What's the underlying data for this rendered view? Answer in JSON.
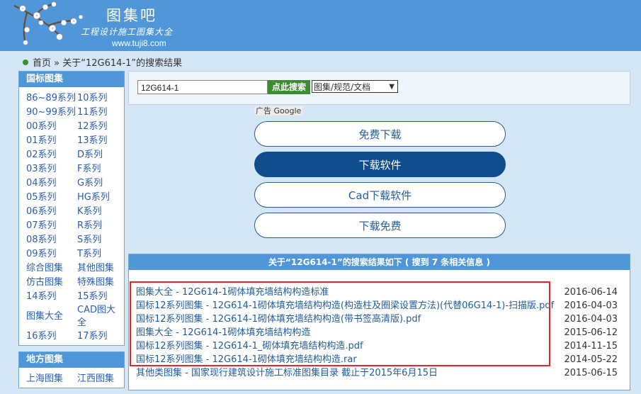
{
  "logo": {
    "title": "图集吧",
    "subtitle": "工程设计施工图集大全",
    "url": "www.tuji8.com"
  },
  "breadcrumb": {
    "home": "首页",
    "sep": "»",
    "current": "关于“12G614-1”的搜索结果"
  },
  "sidebar": {
    "national_title": "国标图集",
    "national_items": [
      "86~89系列",
      "10系列",
      "90~99系列",
      "11系列",
      "00系列",
      "12系列",
      "01系列",
      "13系列",
      "02系列",
      "D系列",
      "03系列",
      "F系列",
      "04系列",
      "G系列",
      "05系列",
      "HG系列",
      "06系列",
      "K系列",
      "07系列",
      "R系列",
      "08系列",
      "S系列",
      "09系列",
      "T系列",
      "综合图集",
      "其他图集",
      "仿古图集",
      "特殊图集",
      "14系列",
      "15系列",
      "图集大全",
      "CAD图大全",
      "16系列",
      "17系列"
    ],
    "local_title": "地方图集",
    "local_items": [
      "上海图集",
      "江西图集"
    ]
  },
  "search": {
    "value": "12G614-1",
    "button": "点此搜索",
    "select": "图集/规范/文档"
  },
  "ad": {
    "label": "广告 Google"
  },
  "buttons": [
    "免费下载",
    "下载软件",
    "Cad下载软件",
    "下载免费"
  ],
  "results": {
    "header": "关于“12G614-1”的搜索结果如下 ( 搜到 7 条相关信息 )",
    "items": [
      {
        "title": "图集大全 - 12G614-1砌体填充墙结构构造标准",
        "date": "2016-06-14"
      },
      {
        "title": "国标12系列图集 - 12G614-1砌体填充墙结构构造(构造柱及圈梁设置方法)(代替06G14-1)-扫描版.pdf",
        "date": "2016-04-03"
      },
      {
        "title": "国标12系列图集 - 12G614-1砌体填充墙结构构造(带书签高清版).pdf",
        "date": "2016-04-03"
      },
      {
        "title": "图集大全 - 12G614-1砌体填充墙结构构造",
        "date": "2015-06-12"
      },
      {
        "title": "国标12系列图集 - 12G614-1_砌体填充墙结构构造.pdf",
        "date": "2014-11-15"
      },
      {
        "title": "国标12系列图集 - 12G614-1砌体填充墙结构构造.rar",
        "date": "2014-05-22"
      },
      {
        "title": "其他类图集 - 国家现行建筑设计施工标准图集目录 截止于2015年6月15日",
        "date": "2015-06-15"
      }
    ]
  },
  "colors": {
    "header_blue": "#4f97d9",
    "button_dark": "#0f4d8d",
    "search_green": "#3c8d2f",
    "highlight_red": "#e0252c"
  }
}
